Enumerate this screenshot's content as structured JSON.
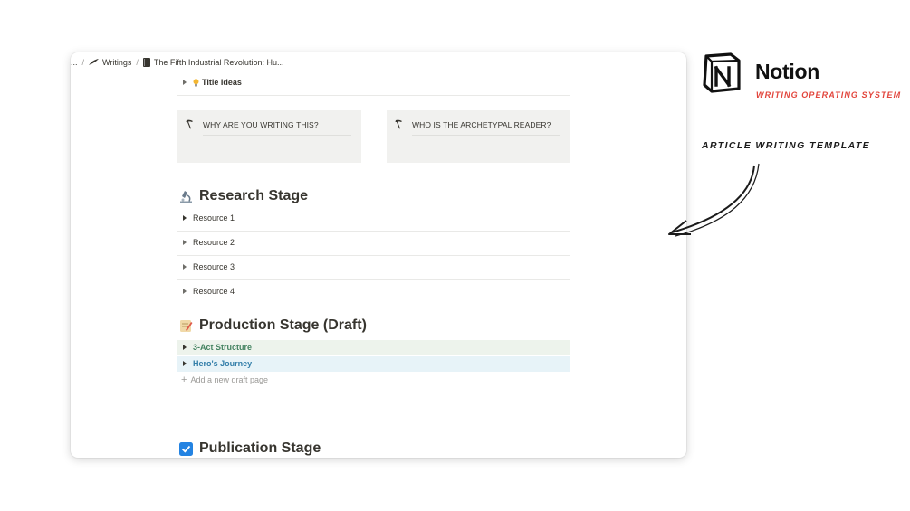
{
  "breadcrumb": {
    "ellipsis": "...",
    "separator": "/",
    "items": [
      {
        "label": "Writings",
        "icon": "quill-icon"
      },
      {
        "label": "The Fifth Industrial Revolution: Hu...",
        "icon": "book-icon"
      }
    ]
  },
  "title_ideas": {
    "label": "Title Ideas",
    "icon": "lightbulb-icon"
  },
  "callouts": [
    {
      "label": "WHY ARE YOU WRITING THIS?",
      "icon": "pickaxe-icon"
    },
    {
      "label": "WHO IS THE ARCHETYPAL READER?",
      "icon": "pickaxe-icon"
    }
  ],
  "research": {
    "heading": "Research Stage",
    "icon": "microscope-icon",
    "resources": [
      "Resource 1",
      "Resource 2",
      "Resource 3",
      "Resource 4"
    ]
  },
  "production": {
    "heading": "Production Stage (Draft)",
    "icon": "memo-icon",
    "items": [
      {
        "label": "3-Act Structure",
        "color": "#448361",
        "bg": "#edf3ec"
      },
      {
        "label": "Hero's Journey",
        "color": "#337ea9",
        "bg": "#e7f3f8"
      }
    ],
    "add_label": "Add a new draft page"
  },
  "publication": {
    "heading": "Publication Stage",
    "icon": "checkbox-icon",
    "icon_color": "#2383e2"
  },
  "branding": {
    "name": "Notion",
    "tagline": "WRITING OPERATING SYSTEM",
    "tagline_color": "#e2453c",
    "template_label": "ARTICLE WRITING TEMPLATE"
  }
}
